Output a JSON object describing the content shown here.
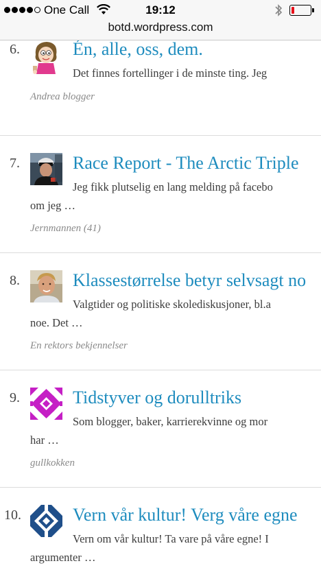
{
  "status_bar": {
    "carrier": "One Call",
    "time": "19:12",
    "battery_level": 0.15,
    "signal_bars_filled": 4,
    "signal_bars_total": 5,
    "battery_color": "#e8101a"
  },
  "browser": {
    "url": "botd.wordpress.com"
  },
  "colors": {
    "title_link": "#1e8cbe",
    "excerpt": "#3c3c3c",
    "author": "#8a8a8a"
  },
  "posts": [
    {
      "number": "6.",
      "title": "Én, alle, oss, dem.",
      "excerpt_line1": "Det finnes fortellinger i de minste ting. Jeg",
      "excerpt_line2": "",
      "author": "Andrea blogger",
      "avatar_icon": "cartoon-girl-avatar"
    },
    {
      "number": "7.",
      "title": "Race Report - The Arctic Triple",
      "excerpt_line1": "Jeg fikk plutselig en lang melding på facebo",
      "excerpt_line2": "om jeg …",
      "author": "Jernmannen (41)",
      "avatar_icon": "cyclist-photo-avatar"
    },
    {
      "number": "8.",
      "title": "Klassestørrelse betyr selvsagt no",
      "excerpt_line1": "Valgtider og politiske skolediskusjoner, bl.a",
      "excerpt_line2": "noe. Det …",
      "author": "En rektors bekjennelser",
      "avatar_icon": "man-portrait-avatar"
    },
    {
      "number": "9.",
      "title": "Tidstyver og dorulltriks",
      "excerpt_line1": "Som blogger, baker, karrierekvinne og mor",
      "excerpt_line2": "har …",
      "author": "gullkokken",
      "avatar_icon": "magenta-quilt-pattern-avatar"
    },
    {
      "number": "10.",
      "title": "Vern vår kultur! Verg våre egne",
      "excerpt_line1": "Vern om vår kultur! Ta vare på våre egne! I",
      "excerpt_line2": "argumenter …",
      "author": "",
      "avatar_icon": "blue-quilt-pattern-avatar"
    }
  ]
}
